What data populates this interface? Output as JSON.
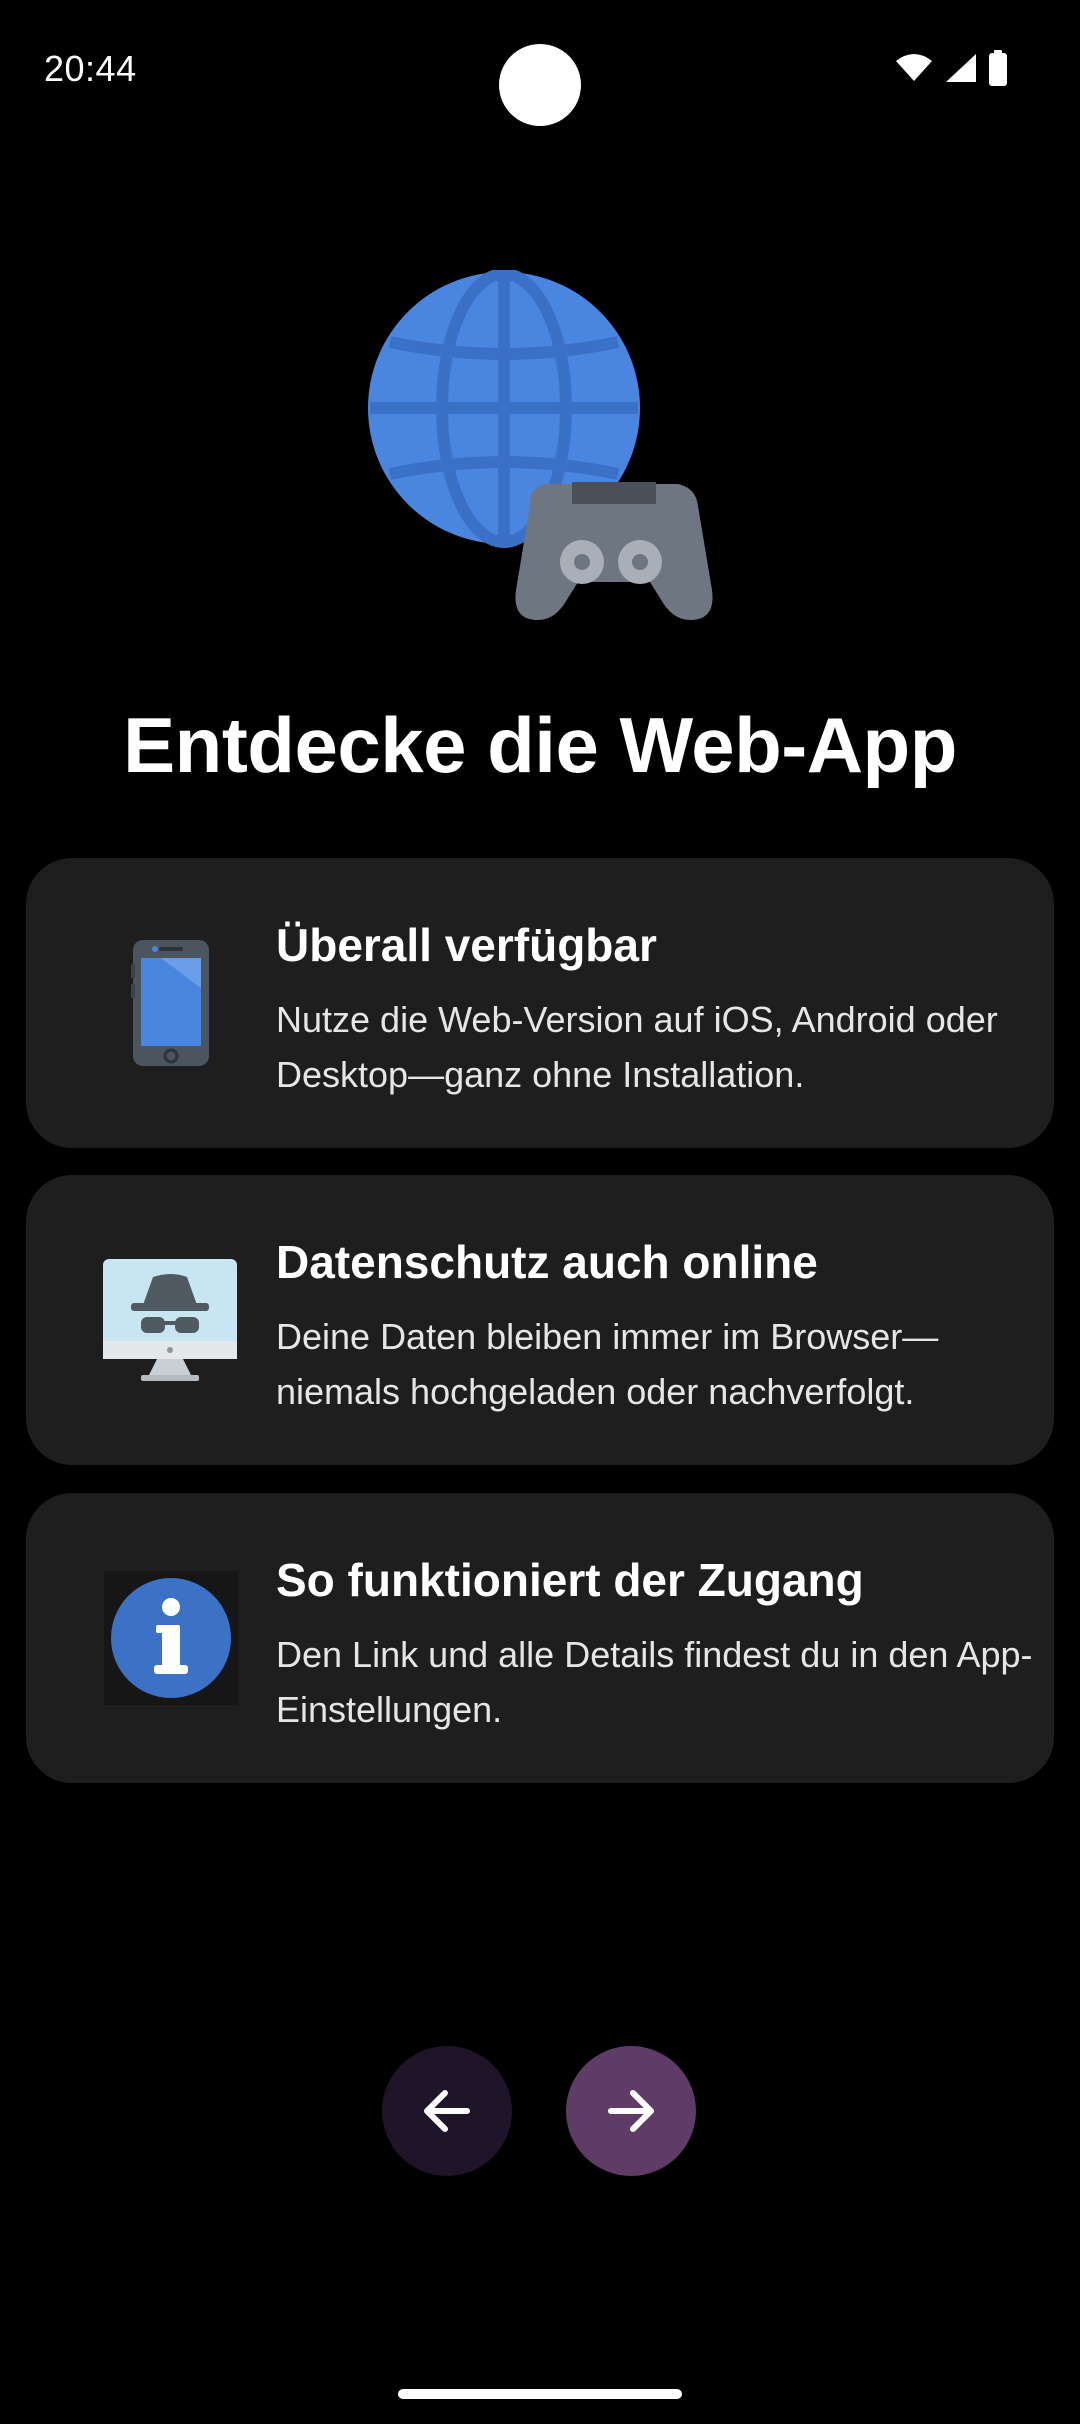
{
  "status_bar": {
    "time": "20:44",
    "icons": [
      "wifi-icon",
      "signal-icon",
      "battery-icon"
    ]
  },
  "hero": {
    "icons": [
      "globe-icon",
      "gamepad-icon"
    ]
  },
  "title": "Entdecke die Web-App",
  "cards": [
    {
      "icon": "smartphone-icon",
      "title": "Überall verfügbar",
      "text": "Nutze die Web-Version auf iOS, Android oder Desktop—ganz ohne Installation."
    },
    {
      "icon": "incognito-monitor-icon",
      "title": "Datenschutz auch online",
      "text": "Deine Daten bleiben immer im Browser—niemals hochgeladen oder nachverfolgt."
    },
    {
      "icon": "info-icon",
      "title": "So funktioniert der Zugang",
      "text": "Den Link und alle Details findest du in den App-Einstellungen."
    }
  ],
  "navigation": {
    "back_icon": "arrow-left-icon",
    "next_icon": "arrow-right-icon"
  },
  "colors": {
    "background": "#000000",
    "card_background": "#1e1e1e",
    "back_button": "#1f1528",
    "next_button": "#5e3c66",
    "globe": "#4a86e0",
    "info_accent": "#3b72c6"
  }
}
